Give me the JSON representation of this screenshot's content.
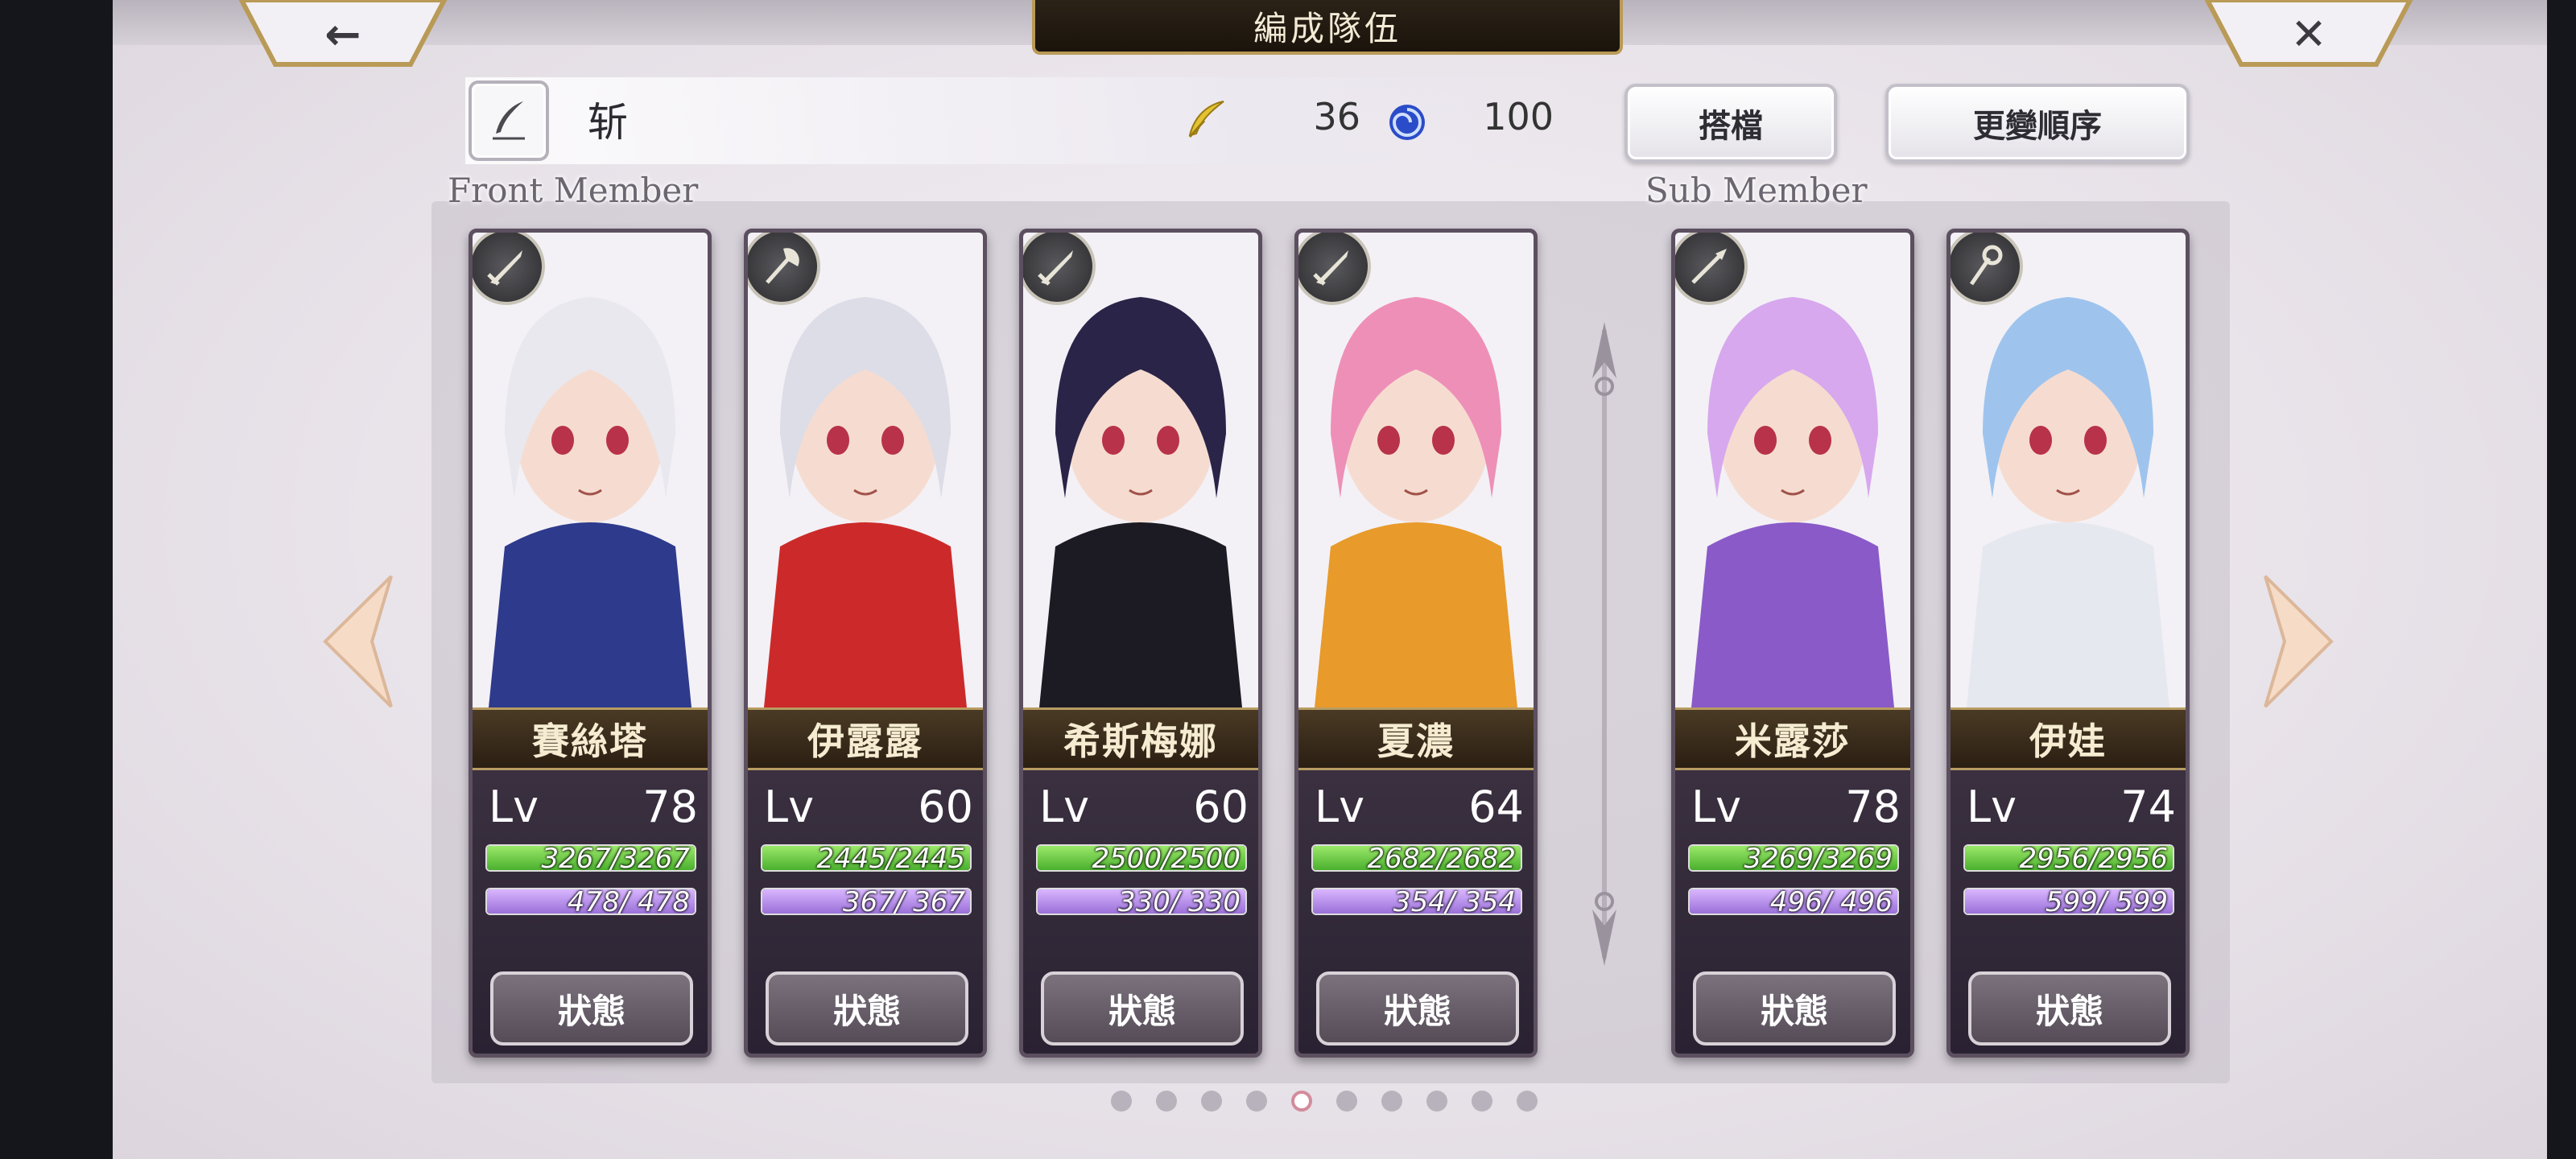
{
  "header": {
    "title": "編成隊伍",
    "back_icon": "back-arrow-icon",
    "close_icon": "close-icon"
  },
  "team": {
    "name": "斩",
    "stat1": "36",
    "stat2": "100"
  },
  "buttons": {
    "partner": "搭檔",
    "change_order": "更變順序"
  },
  "sections": {
    "front": "Front Member",
    "sub": "Sub Member"
  },
  "front_members": [
    {
      "name": "賽絲塔",
      "lv_label": "Lv",
      "lv": "78",
      "hp": "3267/3267",
      "hp_fraction": 1.0,
      "mp": " 478/ 478",
      "mp_fraction": 1.0,
      "status": "狀態",
      "weapon": "sword-icon",
      "hair": "#e8e8ee",
      "accent": "#2e3a8c"
    },
    {
      "name": "伊露露",
      "lv_label": "Lv",
      "lv": "60",
      "hp": "2445/2445",
      "hp_fraction": 1.0,
      "mp": " 367/ 367",
      "mp_fraction": 1.0,
      "status": "狀態",
      "weapon": "axe-icon",
      "hair": "#dcdde6",
      "accent": "#cc2a2a"
    },
    {
      "name": "希斯梅娜",
      "lv_label": "Lv",
      "lv": "60",
      "hp": "2500/2500",
      "hp_fraction": 1.0,
      "mp": " 330/ 330",
      "mp_fraction": 1.0,
      "status": "狀態",
      "weapon": "sword-icon",
      "hair": "#2a2448",
      "accent": "#1c1a22"
    },
    {
      "name": "夏濃",
      "lv_label": "Lv",
      "lv": "64",
      "hp": "2682/2682",
      "hp_fraction": 1.0,
      "mp": " 354/ 354",
      "mp_fraction": 1.0,
      "status": "狀態",
      "weapon": "sword-icon",
      "hair": "#ee8fb8",
      "accent": "#e89a2a"
    }
  ],
  "sub_members": [
    {
      "name": "米露莎",
      "lv_label": "Lv",
      "lv": "78",
      "hp": "3269/3269",
      "hp_fraction": 1.0,
      "mp": " 496/ 496",
      "mp_fraction": 1.0,
      "status": "狀態",
      "weapon": "spear-icon",
      "hair": "#d7a8ee",
      "accent": "#8a5ac8"
    },
    {
      "name": "伊娃",
      "lv_label": "Lv",
      "lv": "74",
      "hp": "2956/2956",
      "hp_fraction": 1.0,
      "mp": " 599/ 599",
      "mp_fraction": 1.0,
      "status": "狀態",
      "weapon": "staff-icon",
      "hair": "#9ec4ee",
      "accent": "#e6e8f0"
    }
  ],
  "pagination": {
    "count": 10,
    "active_index": 4
  },
  "colors": {
    "hp": "#6ad040",
    "mp": "#b58ae8",
    "gold": "#b99a56"
  }
}
